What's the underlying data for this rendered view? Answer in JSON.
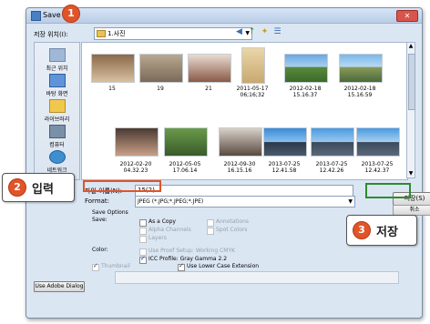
{
  "window": {
    "title": "Save As"
  },
  "location": {
    "label": "저장 위치(I):",
    "value": "1.사진"
  },
  "toolbar": {
    "back": "◀",
    "up": "↑",
    "new_folder": "✦",
    "views": "☰"
  },
  "places": [
    {
      "label": "최근 위치",
      "icon": "recent-places-icon"
    },
    {
      "label": "바탕 화면",
      "icon": "desktop-icon"
    },
    {
      "label": "라이브러리",
      "icon": "libraries-icon"
    },
    {
      "label": "컴퓨터",
      "icon": "computer-icon"
    },
    {
      "label": "네트워크",
      "icon": "network-icon"
    }
  ],
  "files": [
    {
      "name": "15"
    },
    {
      "name": "19"
    },
    {
      "name": "21"
    },
    {
      "name": "2011-05-17 06;16;32"
    },
    {
      "name": "2012-02-18 15.16.37"
    },
    {
      "name": "2012-02-18 15.16.59"
    },
    {
      "name": "2012-02-20 04.32.23"
    },
    {
      "name": "2012-05-05 17.06.14"
    },
    {
      "name": "2012-09-30 16.15.16"
    },
    {
      "name": "2013-07-25 12.41.58"
    },
    {
      "name": "2013-07-25 12.42.26"
    },
    {
      "name": "2013-07-25 12.42.37"
    }
  ],
  "filename": {
    "label": "파일 이름(N):",
    "value": "15(2)"
  },
  "format": {
    "label": "Format:",
    "value": "JPEG (*.JPG;*.JPEG;*.JPE)"
  },
  "buttons": {
    "save": "저장(S)",
    "cancel": "취소",
    "adobe_dialog": "Use Adobe Dialog"
  },
  "save_options": {
    "heading": "Save Options",
    "save_label": "Save:",
    "as_a_copy": "As a Copy",
    "alpha_channels": "Alpha Channels",
    "layers": "Layers",
    "annotations": "Annotations",
    "spot_colors": "Spot Colors"
  },
  "color": {
    "label": "Color:",
    "use_proof_setup": "Use Proof Setup: Working CMYK",
    "icc_profile": "ICC Profile: Gray Gamma 2.2"
  },
  "thumbnail": "Thumbnail",
  "lowercase_ext": "Use Lower Case Extension",
  "annotations": {
    "step1": "1",
    "step2": "2",
    "step2_text": "입력",
    "step3": "3",
    "step3_text": "저장"
  }
}
